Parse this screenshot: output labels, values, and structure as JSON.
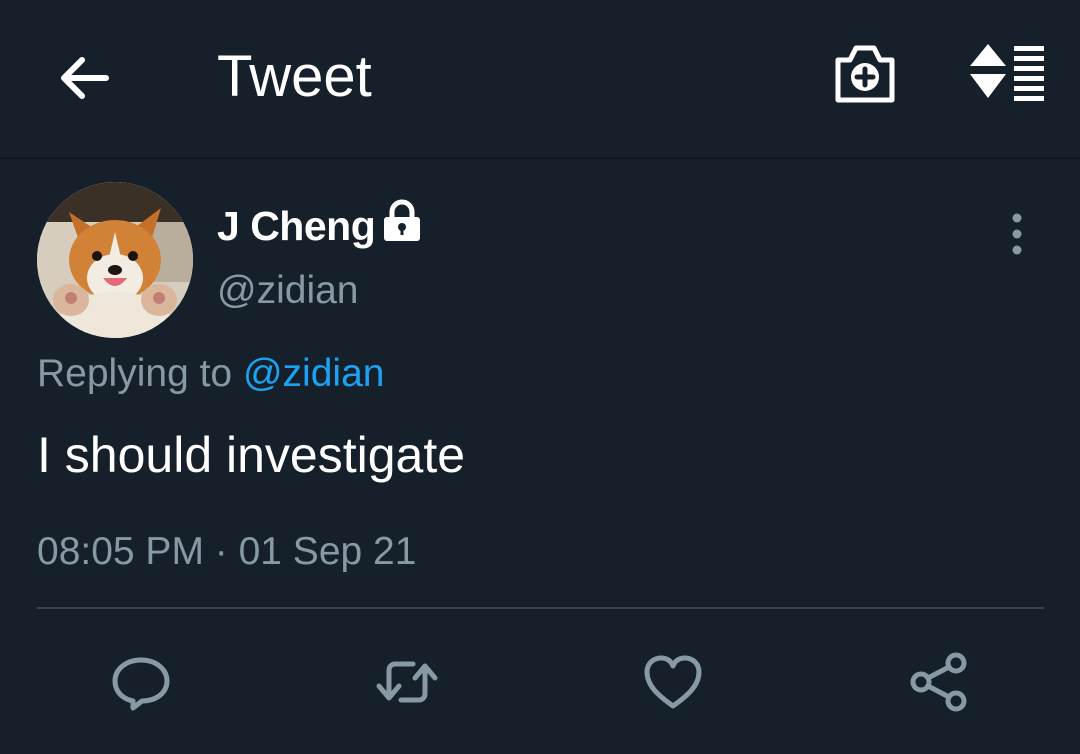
{
  "appbar": {
    "title": "Tweet",
    "back_icon": "arrow-left-icon",
    "camera_icon": "camera-add-icon",
    "sort_icon": "sort-list-icon"
  },
  "tweet": {
    "author_name": "J Cheng",
    "protected_icon": "lock-icon",
    "handle": "@zidian",
    "reply_prefix": "Replying to",
    "reply_to": "@zidian",
    "text": "I should investigate",
    "timestamp": "08:05 PM · 01 Sep 21",
    "more_icon": "more-vertical-icon"
  },
  "actions": [
    {
      "name": "reply",
      "icon": "reply-icon"
    },
    {
      "name": "retweet",
      "icon": "retweet-icon"
    },
    {
      "name": "like",
      "icon": "heart-icon"
    },
    {
      "name": "share",
      "icon": "share-icon"
    }
  ],
  "colors": {
    "background": "#15202b",
    "text_primary": "#ffffff",
    "text_secondary": "#8899a6",
    "accent": "#1da1f2",
    "divider": "#38444d"
  }
}
